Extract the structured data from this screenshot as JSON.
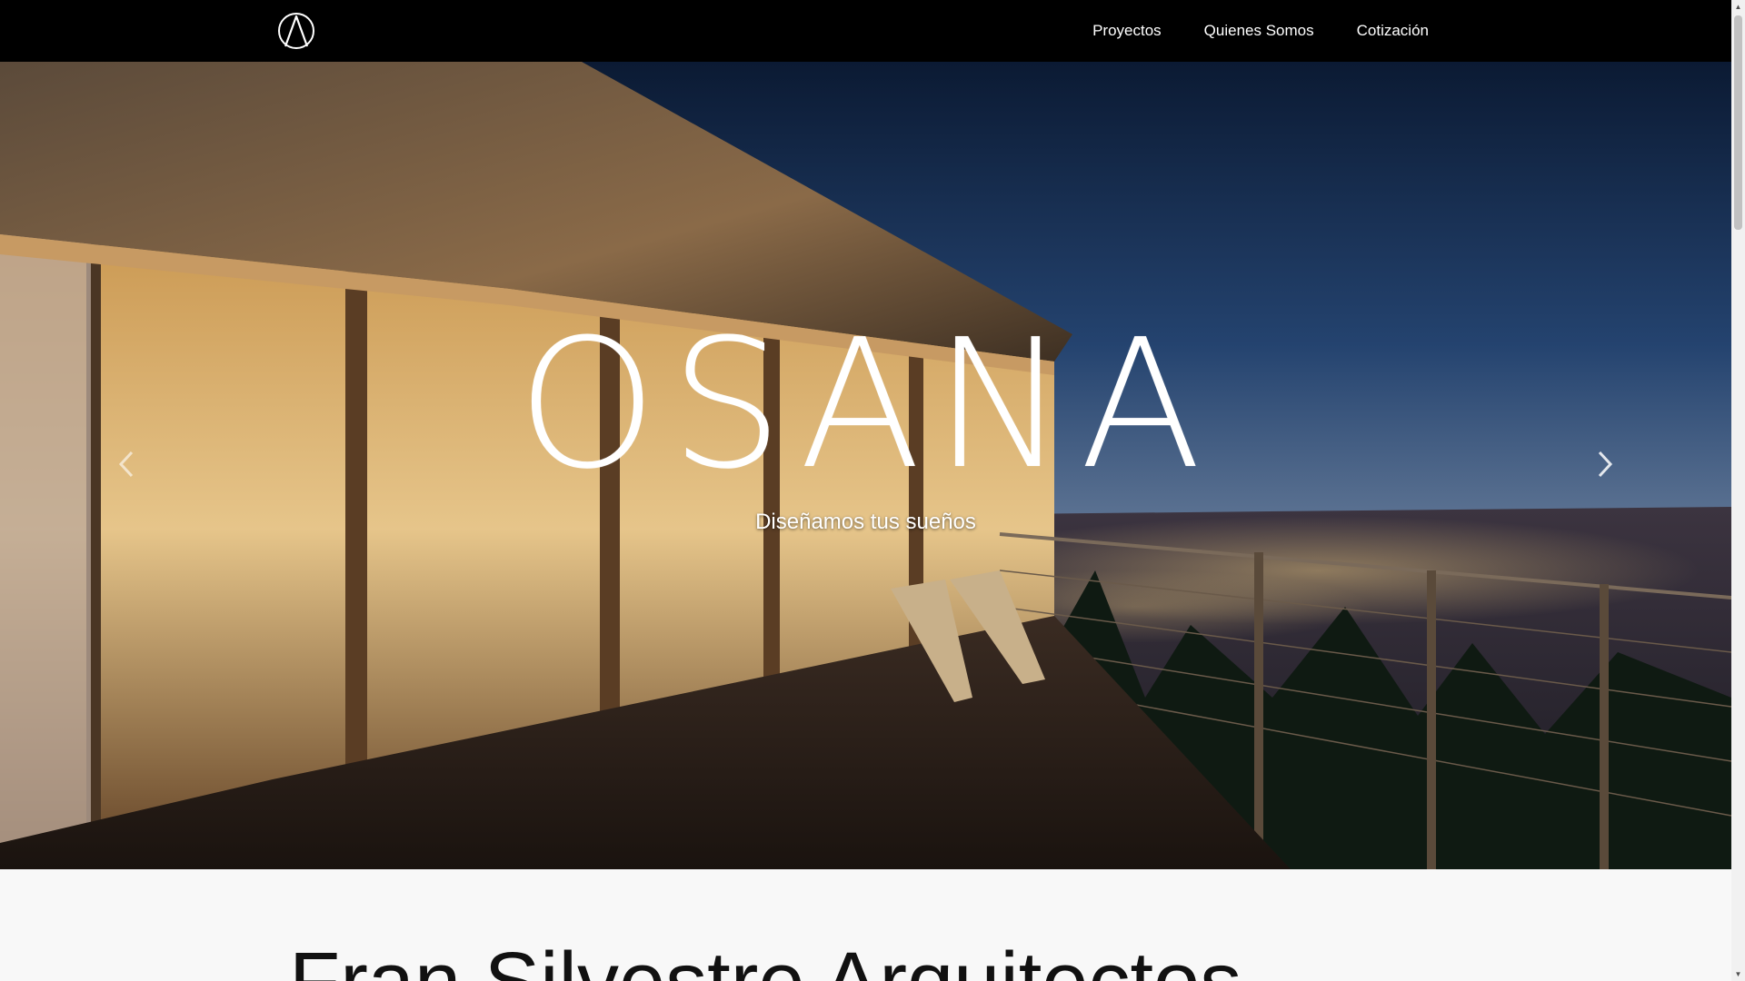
{
  "nav": {
    "logo_icon": "compass-a-logo-icon",
    "links": [
      "Proyectos",
      "Quienes Somos",
      "Cotización"
    ]
  },
  "hero": {
    "title": "OSANA",
    "subtitle": "Diseñamos tus sueños",
    "prev_icon": "chevron-left-icon",
    "next_icon": "chevron-right-icon"
  },
  "main": {
    "heading": "Fran Silvestre Arquitectos"
  },
  "colors": {
    "navbar_bg": "#000000",
    "nav_text": "#ffffff",
    "page_bg": "#f8f8f8"
  }
}
